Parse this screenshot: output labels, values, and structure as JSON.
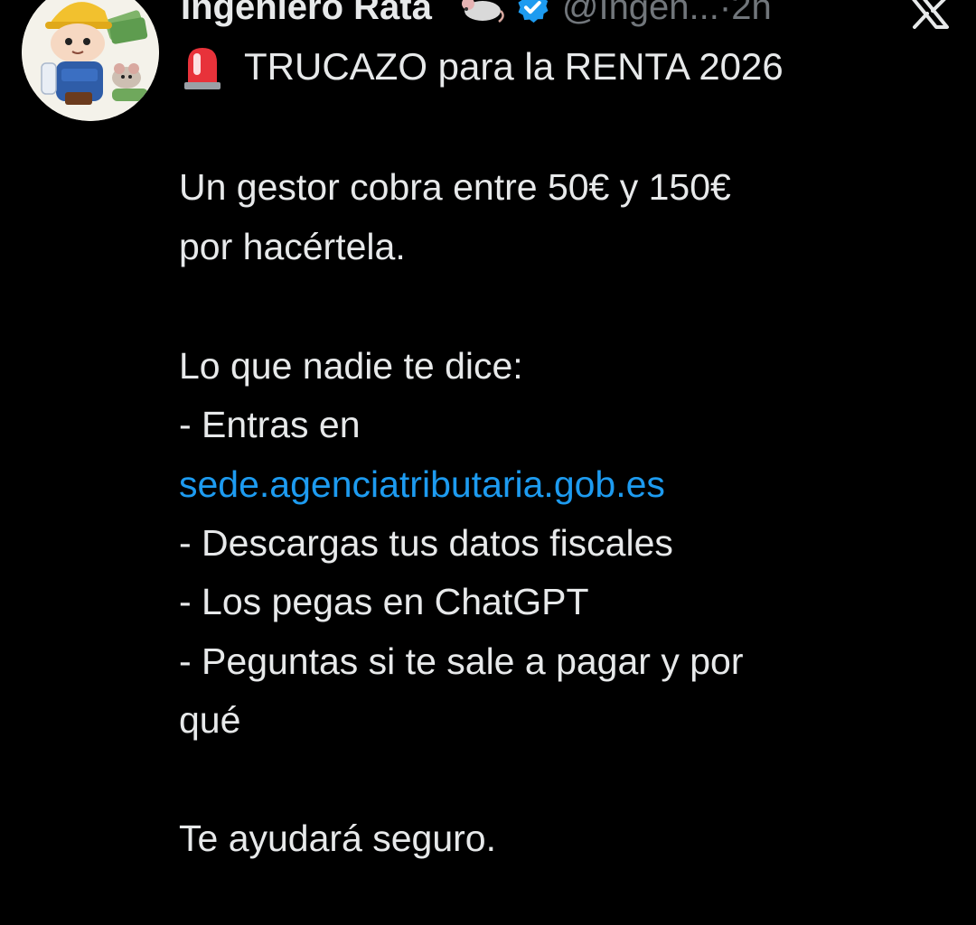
{
  "tweet": {
    "author": {
      "display_name": "Ingeniero Rata",
      "name_emoji_icon": "rat-icon",
      "verified_icon": "verified-badge-icon",
      "handle": "@Ingen...",
      "separator": "·",
      "time": "2h"
    },
    "platform_icon": "x-logo-icon",
    "title": {
      "icon": "siren-icon",
      "text": "TRUCAZO para la RENTA 2026"
    },
    "body": {
      "para1_line1": "Un gestor cobra entre 50€ y 150€",
      "para1_line2": "por hacértela.",
      "para2_intro": "Lo que nadie te dice:",
      "step1": "- Entras en",
      "link": "sede.agenciatributaria.gob.es",
      "step2": "- Descargas tus datos fiscales",
      "step3": "- Los pegas en ChatGPT",
      "step4_line1": "- Peguntas si te sale a pagar y por",
      "step4_line2": "qué",
      "closing": "Te ayudará seguro."
    }
  },
  "colors": {
    "background": "#000000",
    "text": "#e7e9ea",
    "secondary": "#71767b",
    "link": "#1d9bf0",
    "verified": "#1d9bf0"
  }
}
